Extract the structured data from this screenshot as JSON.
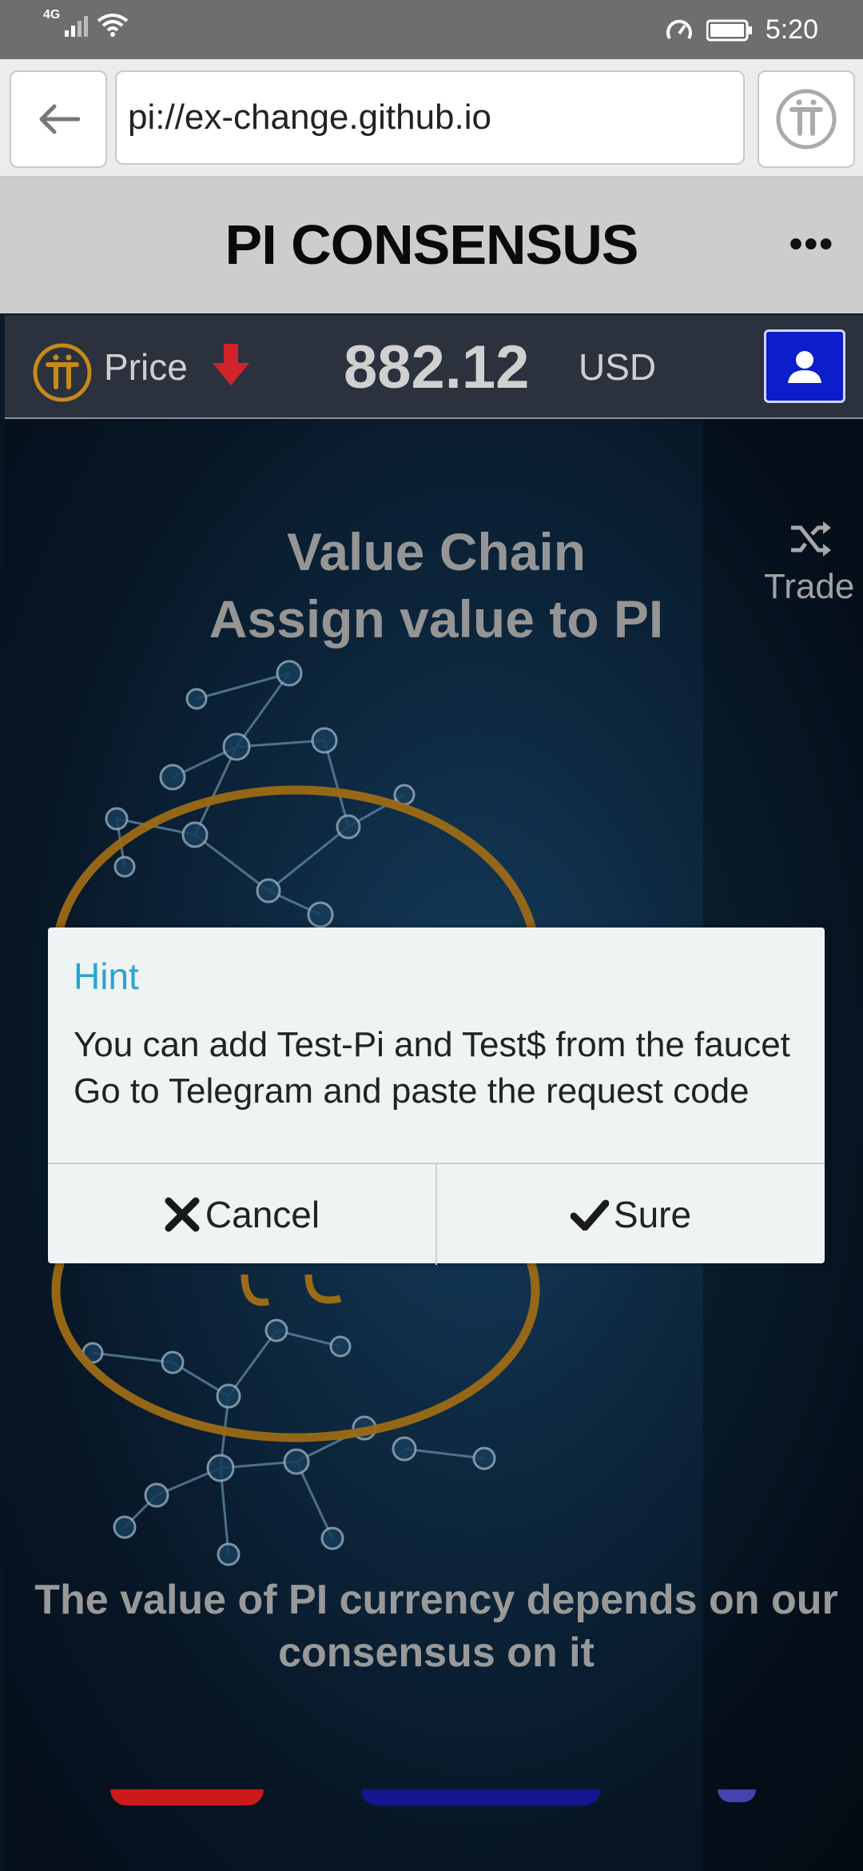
{
  "status_bar": {
    "network": "4G",
    "time": "5:20"
  },
  "browser": {
    "url": "pi://ex-change.github.io"
  },
  "app_header": {
    "title": "PI CONSENSUS",
    "more": "•••"
  },
  "price_bar": {
    "label": "Price",
    "value": "882.12",
    "unit": "USD",
    "trend": "down"
  },
  "hero": {
    "title_line1": "Value Chain",
    "title_line2": "Assign value to PI",
    "trade_label": "Trade",
    "bottom_text": "The value of PI currency depends on our consensus on it"
  },
  "dialog": {
    "title": "Hint",
    "message_line1": "You can add Test-Pi and Test$ from the faucet",
    "message_line2": "Go to Telegram and paste the request code",
    "cancel_label": "Cancel",
    "sure_label": "Sure"
  },
  "colors": {
    "pi_gold": "#c8891b",
    "hint_blue": "#2aa5d2",
    "user_button": "#0b1ec9",
    "down_arrow": "#d0242a"
  }
}
